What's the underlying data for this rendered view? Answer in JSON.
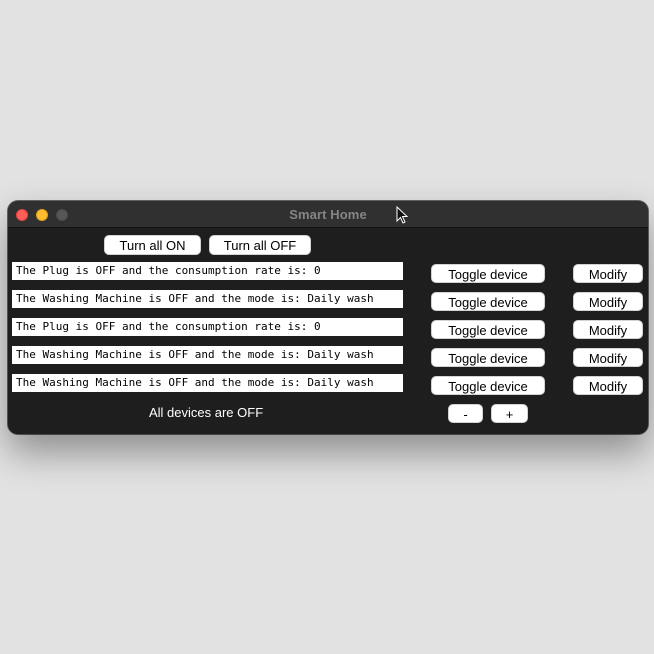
{
  "window": {
    "title": "Smart Home"
  },
  "toolbar": {
    "turn_all_on_label": "Turn all ON",
    "turn_all_off_label": "Turn all OFF"
  },
  "devices": [
    {
      "status_text": "The Plug is OFF and the consumption rate is: 0",
      "toggle_label": "Toggle device",
      "modify_label": "Modify"
    },
    {
      "status_text": "The Washing Machine is OFF and the mode is: Daily wash",
      "toggle_label": "Toggle device",
      "modify_label": "Modify"
    },
    {
      "status_text": "The Plug is OFF and the consumption rate is: 0",
      "toggle_label": "Toggle device",
      "modify_label": "Modify"
    },
    {
      "status_text": "The Washing Machine is OFF and the mode is: Daily wash",
      "toggle_label": "Toggle device",
      "modify_label": "Modify"
    },
    {
      "status_text": "The Washing Machine is OFF and the mode is: Daily wash",
      "toggle_label": "Toggle device",
      "modify_label": "Modify"
    }
  ],
  "footer": {
    "summary_text": "All devices are OFF",
    "minus_label": "-",
    "plus_label": "+"
  },
  "colors": {
    "window_background": "#1f1f1f",
    "titlebar_background": "#303030",
    "button_background": "#ffffff",
    "close_button": "#ff5f57",
    "minimize_button": "#febc2e",
    "zoom_button": "#575757"
  },
  "icons": {
    "close": "close-icon",
    "minimize": "minimize-icon",
    "zoom": "zoom-icon",
    "cursor": "mouse-cursor-icon"
  }
}
